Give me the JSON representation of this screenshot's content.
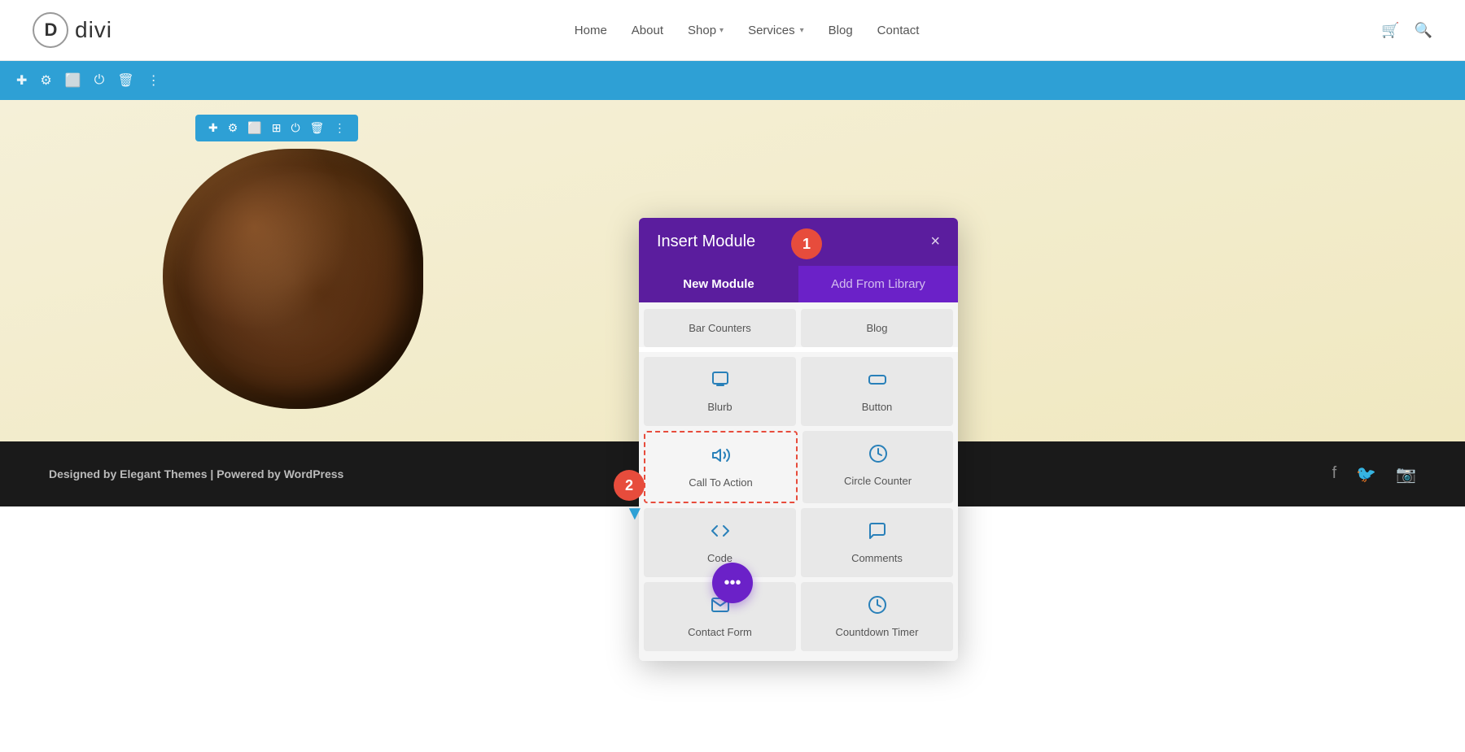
{
  "header": {
    "logo_letter": "D",
    "logo_name": "divi",
    "nav_items": [
      {
        "label": "Home",
        "has_dropdown": false
      },
      {
        "label": "About",
        "has_dropdown": false
      },
      {
        "label": "Shop",
        "has_dropdown": true
      },
      {
        "label": "Services",
        "has_dropdown": true
      },
      {
        "label": "Blog",
        "has_dropdown": false
      },
      {
        "label": "Contact",
        "has_dropdown": false
      }
    ]
  },
  "builder_toolbar": {
    "icons": [
      "plus",
      "gear",
      "copy",
      "power",
      "trash",
      "more"
    ]
  },
  "row_toolbar": {
    "icons": [
      "plus",
      "gear",
      "columns",
      "grid",
      "power",
      "trash",
      "more"
    ]
  },
  "dialog": {
    "title": "Insert Module",
    "close_label": "×",
    "tabs": [
      {
        "label": "New Module",
        "active": true
      },
      {
        "label": "Add From Library",
        "active": false
      }
    ],
    "modules_partial_top": "Bar Counters",
    "modules_partial_top2": "Blog",
    "modules": [
      {
        "id": "blurb",
        "label": "Blurb",
        "icon": "💬"
      },
      {
        "id": "button",
        "label": "Button",
        "icon": "🔲"
      },
      {
        "id": "call-to-action",
        "label": "Call To Action",
        "icon": "📢",
        "highlighted": true
      },
      {
        "id": "circle-counter",
        "label": "Circle Counter",
        "icon": "⏱"
      },
      {
        "id": "code",
        "label": "Code",
        "icon": "💻"
      },
      {
        "id": "comments",
        "label": "Comments",
        "icon": "🗨"
      },
      {
        "id": "contact-form",
        "label": "Contact Form",
        "icon": "✉"
      },
      {
        "id": "countdown-timer",
        "label": "Countdown Timer",
        "icon": "⏰"
      }
    ]
  },
  "footer": {
    "designed_by": "Designed by ",
    "elegant_themes": "Elegant Themes",
    "separator": " | Powered by ",
    "wordpress": "WordPress",
    "social": [
      "facebook",
      "twitter",
      "instagram"
    ]
  },
  "badges": {
    "one": "1",
    "two": "2"
  },
  "floating_dots": "•••"
}
